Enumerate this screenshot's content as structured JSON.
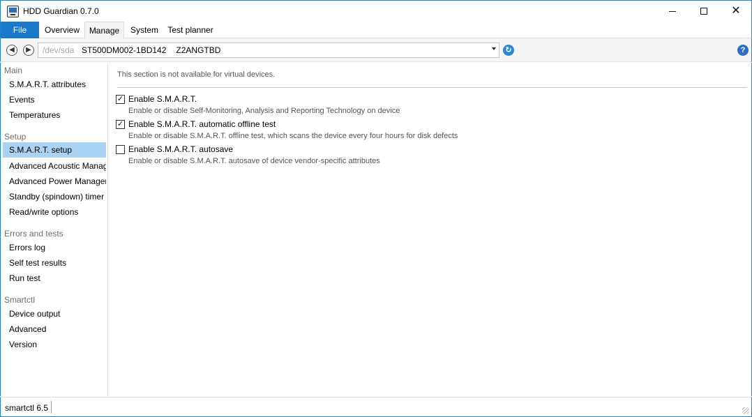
{
  "window": {
    "title": "HDD Guardian 0.7.0",
    "minimize": "minimize",
    "maximize": "maximize",
    "close": "✕"
  },
  "tabs": {
    "file": "File",
    "overview": "Overview",
    "manage": "Manage",
    "system": "System",
    "planner": "Test planner"
  },
  "device": {
    "path": "/dev/sda",
    "model": "ST500DM002-1BD142",
    "serial": "Z2ANGTBD"
  },
  "sidebar": {
    "main": {
      "label": "Main",
      "items": [
        "S.M.A.R.T. attributes",
        "Events",
        "Temperatures"
      ]
    },
    "setup": {
      "label": "Setup",
      "items": [
        "S.M.A.R.T. setup",
        "Advanced Acoustic Management",
        "Advanced Power Management",
        "Standby (spindown) timer",
        "Read/write options"
      ]
    },
    "errors": {
      "label": "Errors and tests",
      "items": [
        "Errors log",
        "Self test results",
        "Run test"
      ]
    },
    "smartctl": {
      "label": "Smartctl",
      "items": [
        "Device output",
        "Advanced",
        "Version"
      ]
    },
    "selected": "S.M.A.R.T. setup"
  },
  "content": {
    "notice": "This section is not available for virtual devices.",
    "options": [
      {
        "label": "Enable S.M.A.R.T.",
        "desc": "Enable or disable Self-Monitoring, Analysis and Reporting Technology on device",
        "checked": true
      },
      {
        "label": "Enable S.M.A.R.T. automatic offline test",
        "desc": "Enable or disable S.M.A.R.T. offline test, which scans the device every four hours for disk defects",
        "checked": true
      },
      {
        "label": "Enable S.M.A.R.T. autosave",
        "desc": "Enable or disable S.M.A.R.T. autosave of device vendor-specific attributes",
        "checked": false
      }
    ]
  },
  "status": {
    "text": "smartctl 6.5"
  },
  "colors": {
    "accent": "#1979ca",
    "selection": "#a9d2f3",
    "window_border": "#1883d7"
  }
}
